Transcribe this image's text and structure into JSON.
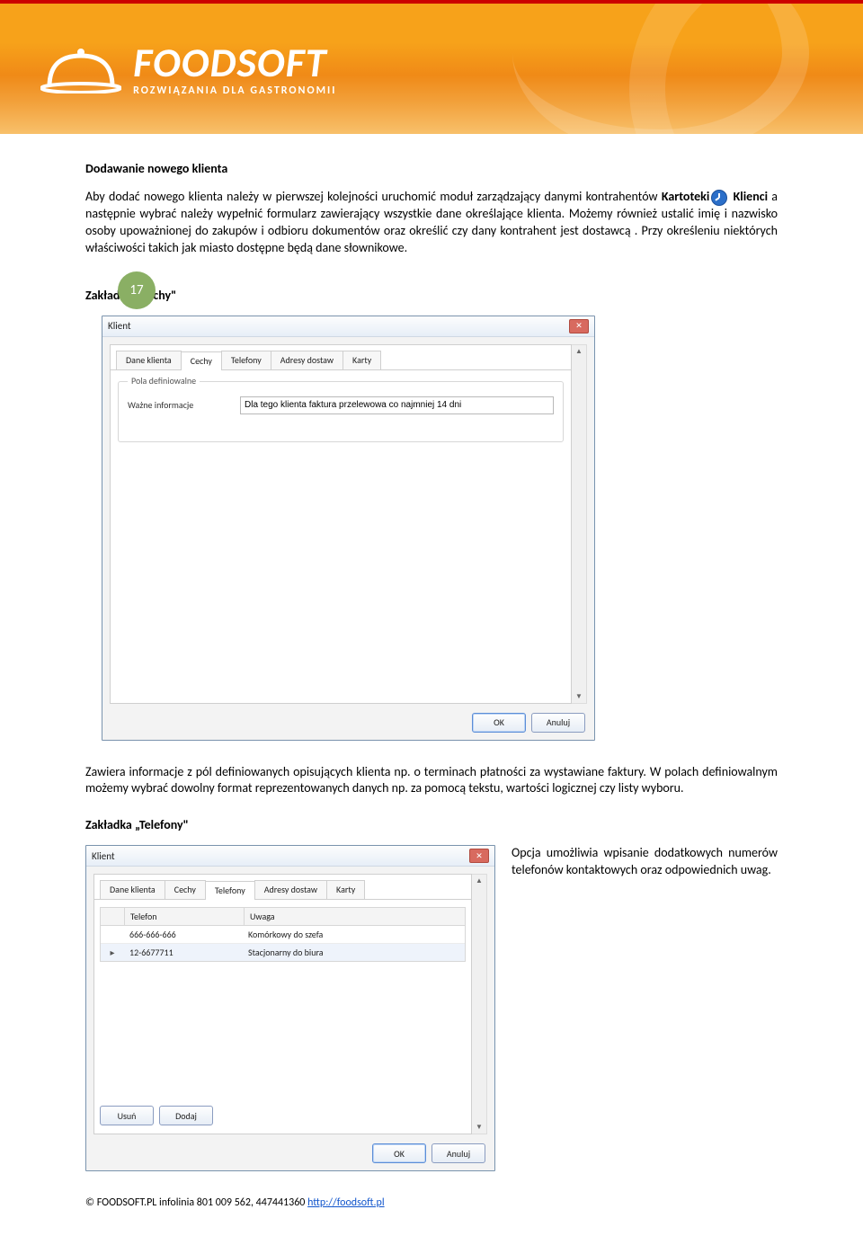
{
  "header": {
    "brand_main": "FOODSOFT",
    "brand_sub": "ROZWIĄZANIA DLA GASTRONOMII"
  },
  "page_number": "17",
  "section": {
    "title": "Dodawanie nowego klienta",
    "para1a": "Aby dodać nowego klienta należy w pierwszej kolejności uruchomić moduł zarządzający danymi kontrahentów ",
    "para1b": "Kartoteki",
    "para1c": " Klienci",
    "para1d": " a następnie wybrać należy wypełnić formularz zawierający wszystkie dane określające klienta. Możemy również ustalić imię i nazwisko osoby upoważnionej do zakupów i odbioru dokumentów oraz określić czy dany kontrahent jest dostawcą . Przy określeniu niektórych właściwości takich jak miasto dostępne będą dane słownikowe.",
    "cechy_title": "Zakładka „Cechy\"",
    "cechy_para": "Zawiera informacje z pól definiowanych opisujących klienta np. o terminach płatności za wystawiane faktury. W polach definiowalnym możemy wybrać dowolny format reprezentowanych danych np. za pomocą tekstu, wartości logicznej czy listy wyboru.",
    "telefony_title": "Zakładka „Telefony\"",
    "telefony_para": "Opcja umożliwia wpisanie dodatkowych numerów telefonów kontaktowych oraz odpowiednich uwag."
  },
  "dialog_common": {
    "title": "Klient",
    "ok": "OK",
    "cancel": "Anuluj",
    "tabs": {
      "dane": "Dane klienta",
      "cechy": "Cechy",
      "telefony": "Telefony",
      "adresy": "Adresy dostaw",
      "karty": "Karty"
    }
  },
  "cechy_dialog": {
    "group_legend": "Pola definiowalne",
    "field_label": "Ważne informacje",
    "field_value": "Dla tego klienta faktura przelewowa co najmniej 14 dni"
  },
  "tel_dialog": {
    "col_tel": "Telefon",
    "col_uw": "Uwaga",
    "rows": [
      {
        "mark": "",
        "tel": "666-666-666",
        "uw": "Komórkowy do szefa"
      },
      {
        "mark": "▸",
        "tel": "12-6677711",
        "uw": "Stacjonarny do biura"
      }
    ],
    "btn_usun": "Usuń",
    "btn_dodaj": "Dodaj"
  },
  "footer": {
    "copyright": "© FOODSOFT.PL infolinia 801 009 562, 447441360 ",
    "link_text": "http://foodsoft.pl"
  }
}
